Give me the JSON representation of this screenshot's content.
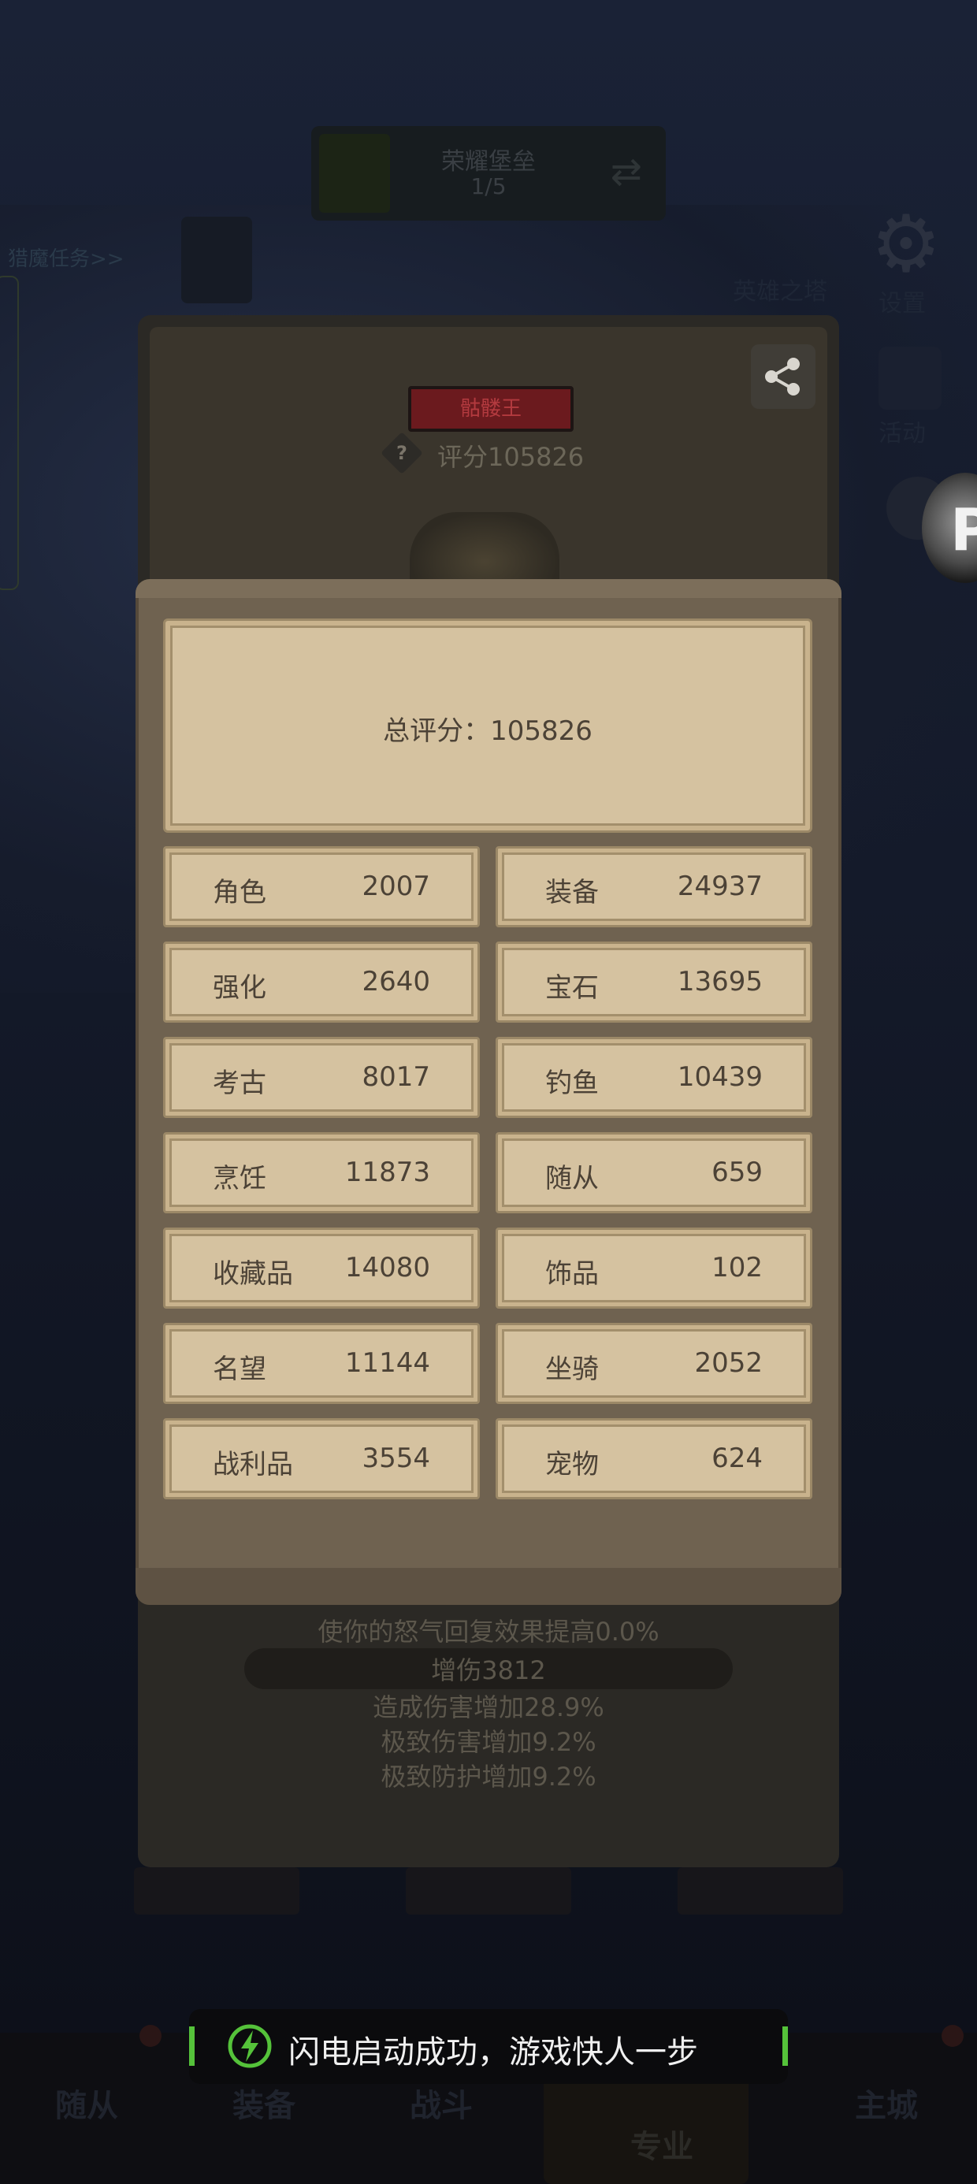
{
  "background": {
    "banner_title": "荣耀堡垒",
    "banner_progress": "1/5",
    "left_link": "猎魔任务>>",
    "right_labels": [
      "英雄之塔",
      "设置",
      "活动"
    ]
  },
  "profile_card": {
    "title_badge": "骷髅王",
    "score_text": "评分105826",
    "help_icon": "?",
    "share_icon": "share-icon",
    "effects": [
      "使你的怒气回复效果提高0.0%",
      "增伤3812",
      "造成伤害增加28.9%",
      "极致伤害增加9.2%",
      "极致防护增加9.2%"
    ]
  },
  "score_modal": {
    "total_label": "总评分：105826",
    "items": [
      {
        "name": "角色",
        "value": "2007"
      },
      {
        "name": "装备",
        "value": "24937"
      },
      {
        "name": "强化",
        "value": "2640"
      },
      {
        "name": "宝石",
        "value": "13695"
      },
      {
        "name": "考古",
        "value": "8017"
      },
      {
        "name": "钓鱼",
        "value": "10439"
      },
      {
        "name": "烹饪",
        "value": "11873"
      },
      {
        "name": "随从",
        "value": "659"
      },
      {
        "name": "收藏品",
        "value": "14080"
      },
      {
        "name": "饰品",
        "value": "102"
      },
      {
        "name": "名望",
        "value": "11144"
      },
      {
        "name": "坐骑",
        "value": "2052"
      },
      {
        "name": "战利品",
        "value": "3554"
      },
      {
        "name": "宠物",
        "value": "624"
      }
    ]
  },
  "bottom_nav": {
    "items": [
      "随从",
      "装备",
      "战斗",
      "专业",
      "主城"
    ]
  },
  "toast": {
    "message": "闪电启动成功，游戏快人一步",
    "icon": "lightning-bolt-icon",
    "accent_color": "#55c23a"
  }
}
